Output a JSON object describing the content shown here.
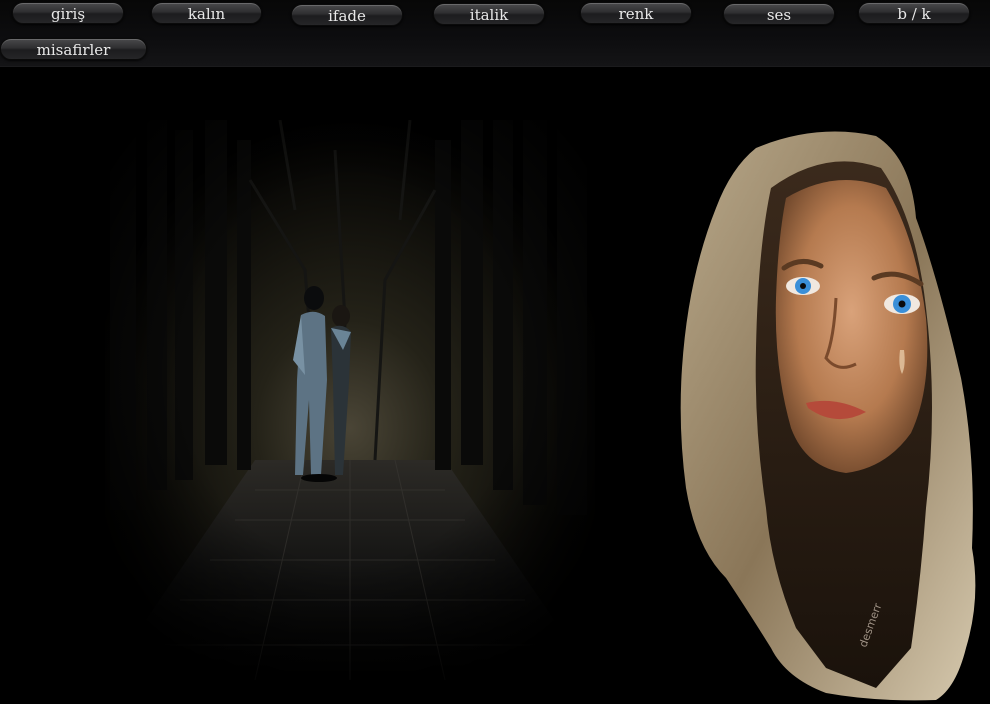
{
  "nav": {
    "items": [
      {
        "label": "giriş"
      },
      {
        "label": "kalın"
      },
      {
        "label": "ifade"
      },
      {
        "label": "italik"
      },
      {
        "label": "renk"
      },
      {
        "label": "ses"
      },
      {
        "label": "b / k"
      },
      {
        "label": "misafirler"
      }
    ]
  },
  "portrait": {
    "signature": "desmerr"
  },
  "colors": {
    "background": "#000000",
    "button_text": "#e8e8e8",
    "button_face": "#2e2e30",
    "eye_blue": "#3a8fd8"
  }
}
